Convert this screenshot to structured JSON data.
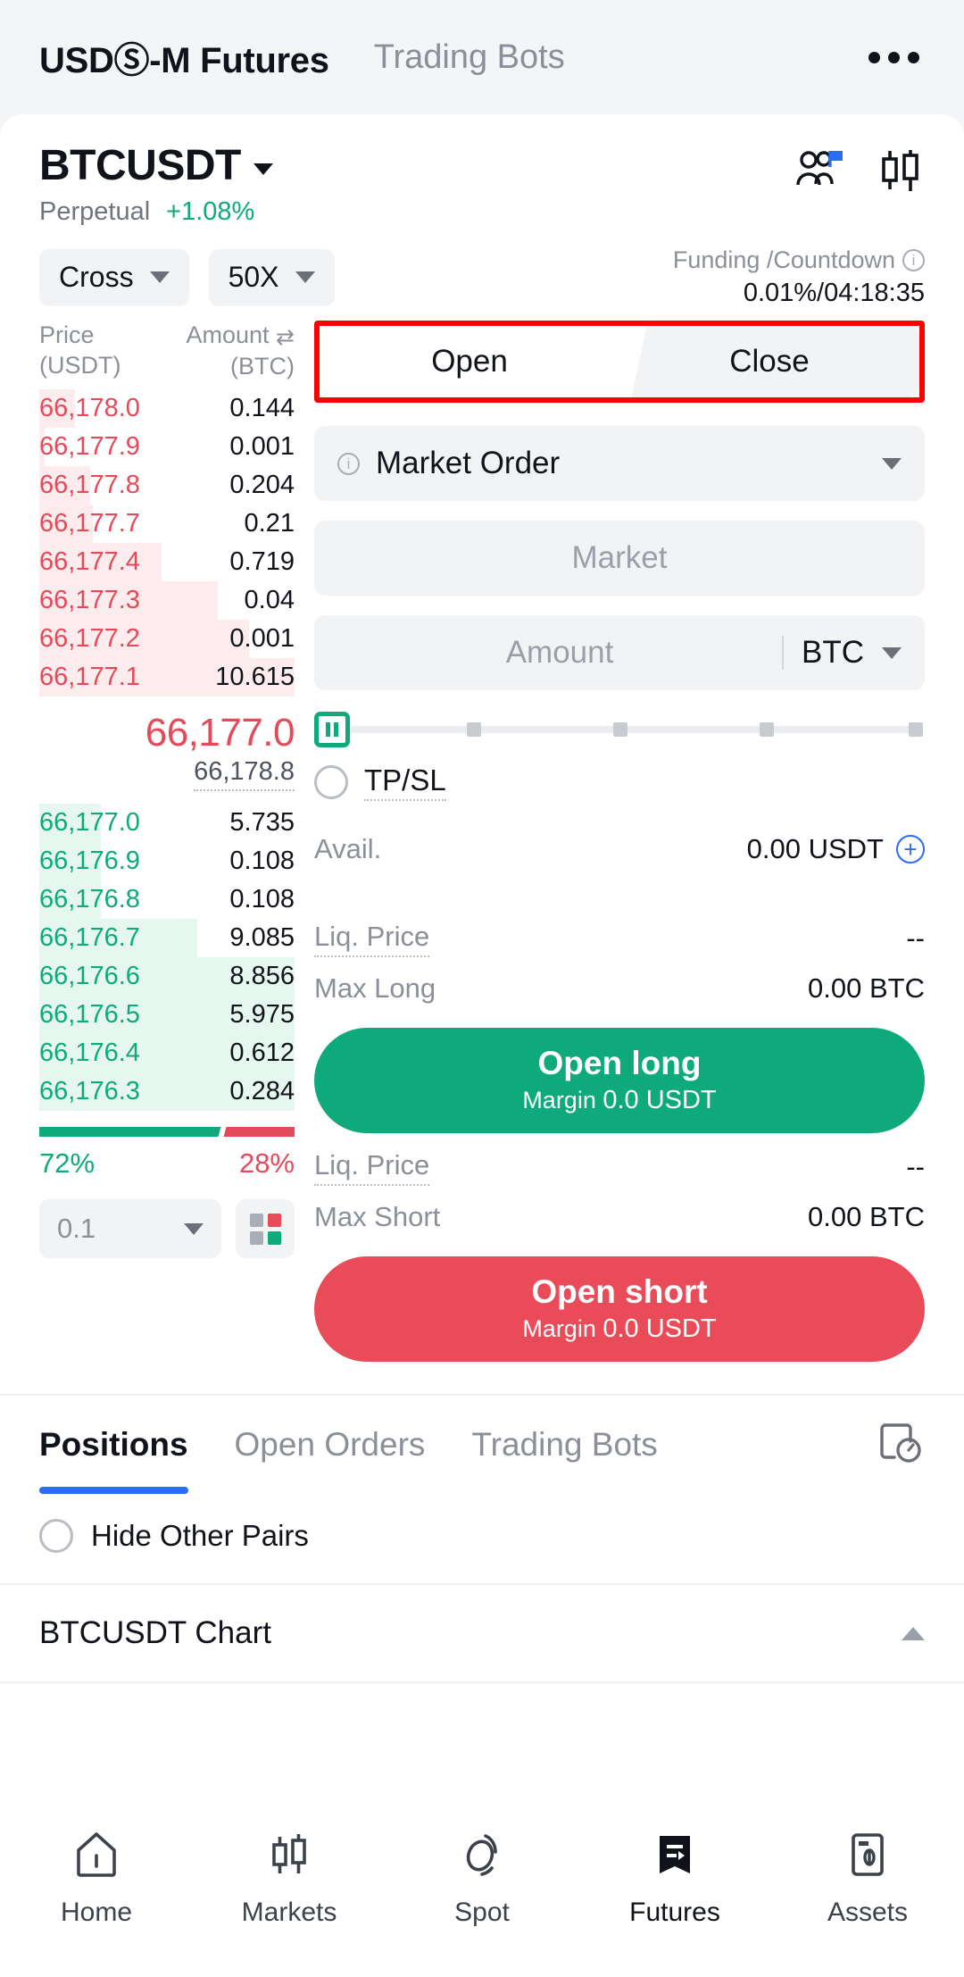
{
  "topbar": {
    "title": "USDⓈ-M Futures",
    "tab": "Trading Bots",
    "more_icon": "more-horizontal-icon"
  },
  "symbol": {
    "name": "BTCUSDT",
    "type": "Perpetual",
    "change": "+1.08%",
    "change_color": "#0eaa7b"
  },
  "margin": {
    "mode": "Cross",
    "leverage": "50X"
  },
  "funding": {
    "label": "Funding /Countdown",
    "value": "0.01%/04:18:35"
  },
  "orderbook": {
    "col_price": "Price",
    "col_price_unit": "(USDT)",
    "col_amount": "Amount",
    "col_amount_unit": "(BTC)",
    "asks": [
      {
        "price": "66,178.0",
        "amount": "0.144",
        "depth": 14
      },
      {
        "price": "66,177.9",
        "amount": "0.001",
        "depth": 2
      },
      {
        "price": "66,177.8",
        "amount": "0.204",
        "depth": 20
      },
      {
        "price": "66,177.7",
        "amount": "0.21",
        "depth": 21
      },
      {
        "price": "66,177.4",
        "amount": "0.719",
        "depth": 48
      },
      {
        "price": "66,177.3",
        "amount": "0.04",
        "depth": 70
      },
      {
        "price": "66,177.2",
        "amount": "0.001",
        "depth": 82
      },
      {
        "price": "66,177.1",
        "amount": "10.615",
        "depth": 100
      }
    ],
    "mid_price": "66,177.0",
    "mid_sub": "66,178.8",
    "bids": [
      {
        "price": "66,177.0",
        "amount": "5.735",
        "depth": 24
      },
      {
        "price": "66,176.9",
        "amount": "0.108",
        "depth": 24
      },
      {
        "price": "66,176.8",
        "amount": "0.108",
        "depth": 24
      },
      {
        "price": "66,176.7",
        "amount": "9.085",
        "depth": 62
      },
      {
        "price": "66,176.6",
        "amount": "8.856",
        "depth": 100
      },
      {
        "price": "66,176.5",
        "amount": "5.975",
        "depth": 100
      },
      {
        "price": "66,176.4",
        "amount": "0.612",
        "depth": 100
      },
      {
        "price": "66,176.3",
        "amount": "0.284",
        "depth": 100
      }
    ],
    "ratio_buy": "72%",
    "ratio_sell": "28%",
    "ratio_buy_pct": 72,
    "precision": "0.1"
  },
  "trade": {
    "tab_open": "Open",
    "tab_close": "Close",
    "order_type": "Market Order",
    "price_placeholder": "Market",
    "amount_placeholder": "Amount",
    "amount_unit": "BTC",
    "tpsl_label": "TP/SL",
    "avail_label": "Avail.",
    "avail_value": "0.00 USDT",
    "long": {
      "liq_label": "Liq. Price",
      "liq_value": "--",
      "max_label": "Max Long",
      "max_value": "0.00 BTC",
      "cta": "Open long",
      "margin_label": "Margin",
      "margin_value": "0.0 USDT"
    },
    "short": {
      "liq_label": "Liq. Price",
      "liq_value": "--",
      "max_label": "Max Short",
      "max_value": "0.00 BTC",
      "cta": "Open short",
      "margin_label": "Margin",
      "margin_value": "0.0 USDT"
    }
  },
  "lower_tabs": {
    "items": [
      "Positions",
      "Open Orders",
      "Trading Bots"
    ],
    "active_index": 0,
    "history_icon": "order-history-icon",
    "hide_other_pairs": "Hide Other Pairs"
  },
  "chart_section": {
    "label": "BTCUSDT Chart"
  },
  "nav": {
    "items": [
      {
        "label": "Home",
        "icon": "home-icon"
      },
      {
        "label": "Markets",
        "icon": "candlestick-icon"
      },
      {
        "label": "Spot",
        "icon": "spot-swap-icon"
      },
      {
        "label": "Futures",
        "icon": "futures-icon"
      },
      {
        "label": "Assets",
        "icon": "assets-icon"
      }
    ],
    "active_index": 3
  },
  "colors": {
    "green": "#0eaa7b",
    "red": "#e34a5a",
    "blue": "#2b6cf5",
    "highlight_box": "#ff0000"
  }
}
